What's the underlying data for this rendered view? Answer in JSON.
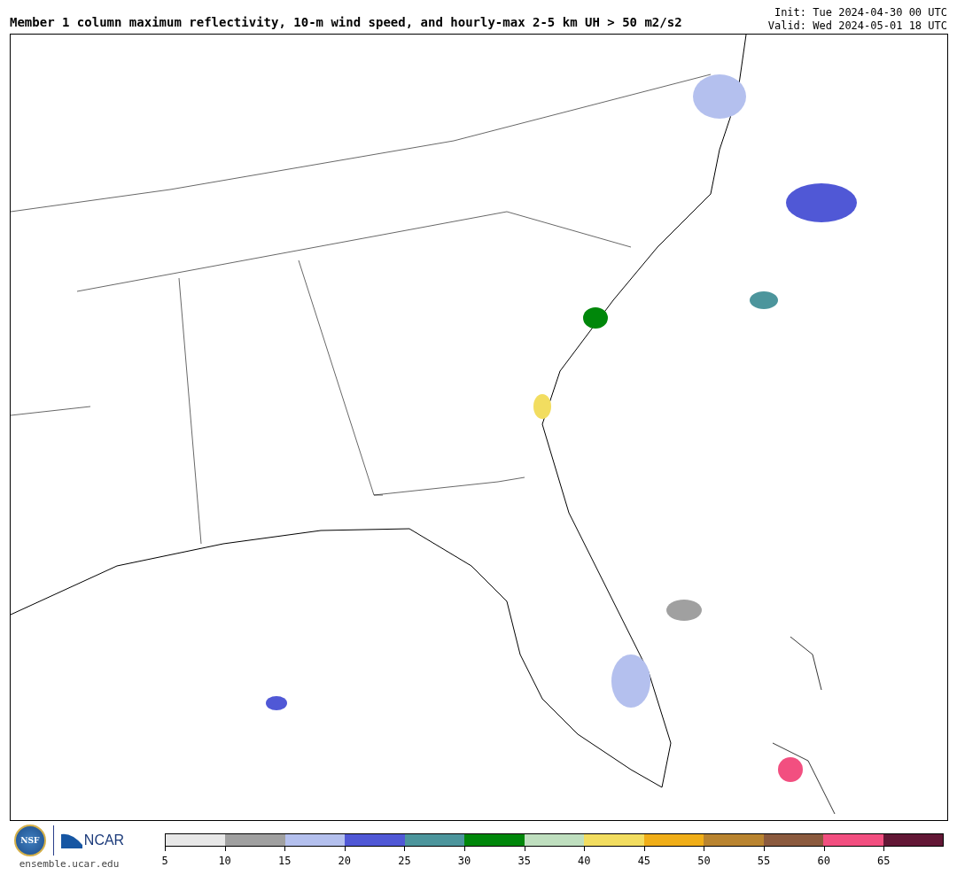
{
  "title": "Member 1 column maximum reflectivity, 10-m wind speed, and hourly-max 2-5 km UH > 50 m2/s2",
  "init": "Init: Tue 2024-04-30 00 UTC",
  "valid": "Valid: Wed 2024-05-01 18 UTC",
  "logos": {
    "nsf": "NSF",
    "ncar": "NCAR",
    "url": "ensemble.ucar.edu"
  },
  "colorbar": {
    "bins": [
      {
        "color": "#e8e8e8"
      },
      {
        "color": "#a0a0a0"
      },
      {
        "color": "#b4c0ee"
      },
      {
        "color": "#5058d6"
      },
      {
        "color": "#4c959c"
      },
      {
        "color": "#00870a"
      },
      {
        "color": "#bfdfbf"
      },
      {
        "color": "#f2dd60"
      },
      {
        "color": "#f0ae18"
      },
      {
        "color": "#b98430"
      },
      {
        "color": "#8b5a3e"
      },
      {
        "color": "#f24f80"
      },
      {
        "color": "#621735"
      }
    ],
    "ticks": [
      "5",
      "10",
      "15",
      "20",
      "25",
      "30",
      "35",
      "40",
      "45",
      "50",
      "55",
      "60",
      "65"
    ]
  }
}
